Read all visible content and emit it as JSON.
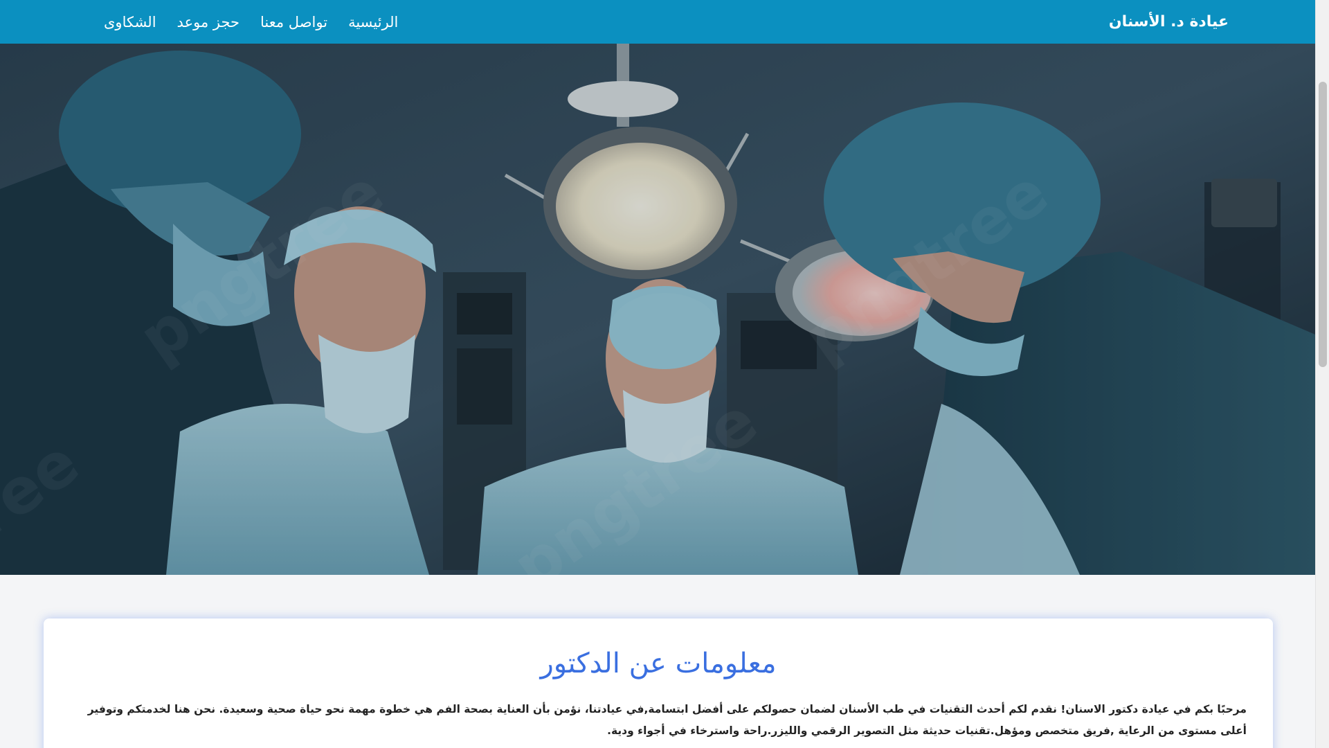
{
  "navbar": {
    "brand": "عيادة د. الأسنان",
    "links": [
      "الرئيسية",
      "تواصل معنا",
      "حجز موعد",
      "الشكاوى"
    ]
  },
  "hero": {
    "image": "surgeons-operating-room-photo"
  },
  "about": {
    "title": "معلومات عن الدكتور",
    "text": "مرحبًا بكم في عيادة دكتور الاسنان! نقدم لكم أحدث التقنيات في طب الأسنان لضمان حصولكم على أفضل ابتسامة,في عيادتنا، نؤمن بأن العناية بصحة الفم هي خطوة مهمة نحو حياة صحية وسعيدة. نحن هنا لخدمتكم وتوفير أعلى مستوى من الرعاية ,فريق متخصص ومؤهل.تقنيات حديثة مثل التصوير الرقمي والليزر.راحة واسترخاء في أجواء ودية."
  },
  "colors": {
    "navbar_bg": "#0b90c0",
    "title_blue": "#3a6fe0"
  }
}
